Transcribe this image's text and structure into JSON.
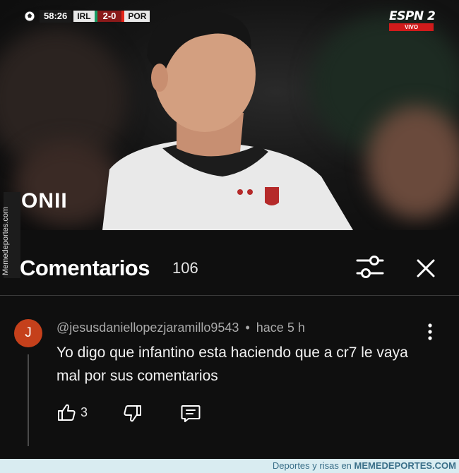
{
  "video": {
    "scorebug": {
      "time": "58:26",
      "home": "IRL",
      "score": "2-0",
      "away": "POR"
    },
    "broadcaster": {
      "logo": "ESPN 2",
      "live": "VIVO"
    },
    "overlay_logo": "ONII",
    "colors": {
      "score_bg": "#8a1a1a",
      "live_bg": "#d01b1b"
    }
  },
  "side_watermark": "Memedeportes.com",
  "comments_panel": {
    "title": "Comentarios",
    "count": "106",
    "filter_icon": "sliders-icon",
    "close_icon": "close-icon"
  },
  "comment": {
    "avatar_letter": "J",
    "avatar_color": "#c5401b",
    "author": "@jesusdaniellopezjaramillo9543",
    "separator": "•",
    "time": "hace 5 h",
    "text": "Yo digo que infantino esta haciendo que a cr7 le vaya mal por sus comentarios",
    "likes": "3",
    "icons": [
      "thumb-up-icon",
      "thumb-down-icon",
      "reply-icon",
      "more-vert-icon"
    ]
  },
  "footer": {
    "tagline": "Deportes y risas en",
    "brand": "MEMEDEPORTES.COM"
  }
}
